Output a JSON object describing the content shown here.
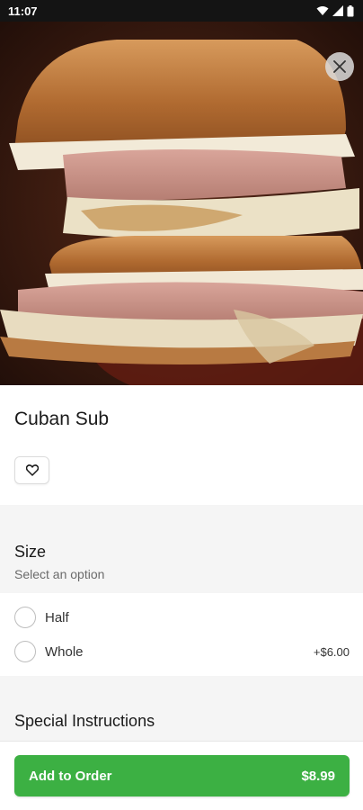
{
  "status_bar": {
    "time": "11:07",
    "icons": [
      "wifi-icon",
      "cellular-signal-icon",
      "battery-icon"
    ]
  },
  "hero_image": {
    "subject": "cuban-sandwich-photo"
  },
  "close_icon": "close-icon",
  "item": {
    "title": "Cuban Sub",
    "favorite_icon": "heart-icon"
  },
  "size": {
    "title": "Size",
    "subtitle": "Select an option",
    "options": [
      {
        "label": "Half",
        "price": "",
        "selected": false
      },
      {
        "label": "Whole",
        "price": "+$6.00",
        "selected": false
      }
    ]
  },
  "special_instructions": {
    "title": "Special Instructions"
  },
  "add_to_order": {
    "label": "Add to Order",
    "price": "$8.99"
  },
  "colors": {
    "accent_green": "#3cb043",
    "section_gray": "#f5f5f5",
    "status_bar": "#141414"
  }
}
